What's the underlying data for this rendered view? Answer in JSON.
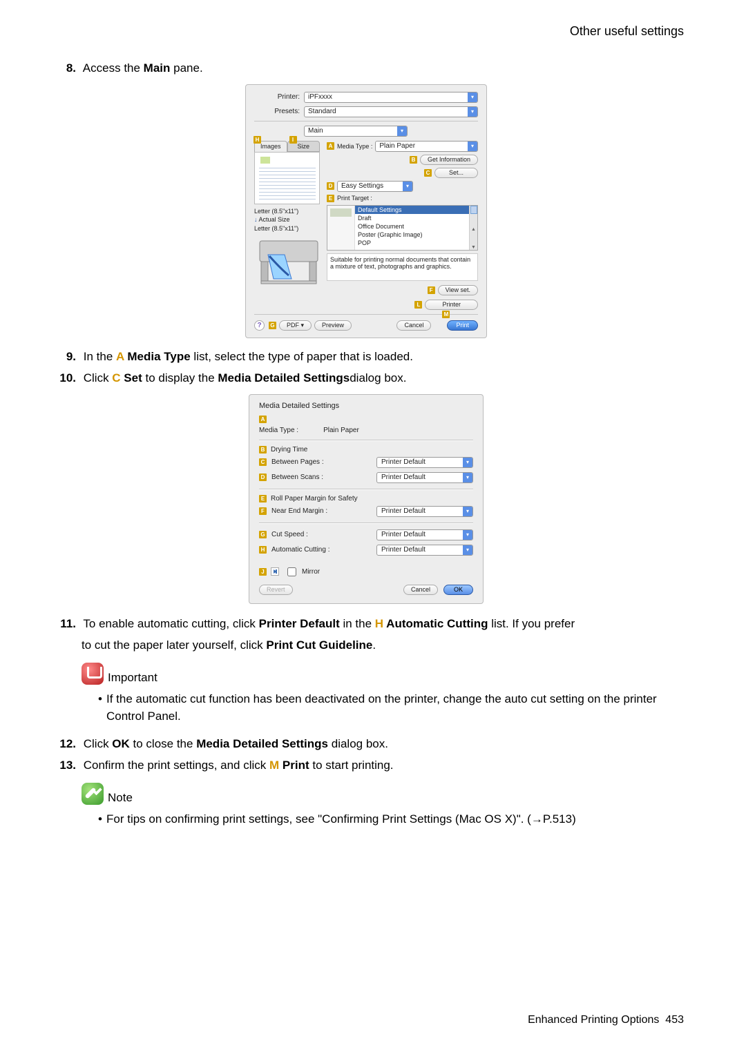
{
  "header": {
    "section_title": "Other useful settings"
  },
  "steps": {
    "s8": {
      "num": "8.",
      "text_pre": "Access the ",
      "bold": "Main",
      "text_post": " pane."
    },
    "s9": {
      "num": "9.",
      "text_pre": "In the ",
      "letter": "A",
      "bold": " Media Type",
      "text_post": " list, select the type of paper that is loaded."
    },
    "s10": {
      "num": "10.",
      "text_pre": "Click ",
      "letter": "C",
      "bold": " Set",
      "text_mid": " to display the ",
      "bold2": "Media Detailed Settings",
      "text_post": "dialog box."
    },
    "s11": {
      "num": "11.",
      "text1": "To enable automatic cutting, click ",
      "b1": "Printer Default",
      "text2": " in the ",
      "letter": "H",
      "b2": " Automatic Cutting",
      "text3": " list. If you prefer",
      "line2a": "to cut the paper later yourself, click ",
      "line2b": "Print Cut Guideline",
      "line2c": "."
    },
    "s12": {
      "num": "12.",
      "t1": "Click ",
      "b1": "OK",
      "t2": " to close the ",
      "b2": "Media Detailed Settings",
      "t3": " dialog box."
    },
    "s13": {
      "num": "13.",
      "t1": "Confirm the print settings, and click ",
      "letter": "M",
      "b1": " Print",
      "t2": " to start printing."
    }
  },
  "dialog1": {
    "printer_lbl": "Printer:",
    "printer_val": "iPFxxxx",
    "presets_lbl": "Presets:",
    "presets_val": "Standard",
    "pane_val": "Main",
    "tab_images": "Images",
    "tab_size": "Size",
    "media_type_lbl": "Media Type :",
    "media_type_val": "Plain Paper",
    "get_info": "Get Information",
    "set_btn": "Set...",
    "easy_lbl": "Easy Settings",
    "target_lbl": "Print Target :",
    "items": {
      "i0": "Default Settings",
      "i1": "Draft",
      "i2": "Office Document",
      "i3": "Poster (Graphic Image)",
      "i4": "POP"
    },
    "desc": "Suitable for printing normal documents that contain a mixture of text, photographs and graphics.",
    "viewset": "View set.",
    "printerbtn": "Printer",
    "size1": "Letter (8.5\"x11\")",
    "size_actual": "Actual Size",
    "size2": "Letter (8.5\"x11\")",
    "pdf": "PDF ▾",
    "preview": "Preview",
    "cancel": "Cancel",
    "print": "Print",
    "tag_H": "H",
    "tag_I": "I",
    "tag_A": "A",
    "tag_B": "B",
    "tag_C": "C",
    "tag_D": "D",
    "tag_E": "E",
    "tag_F": "F",
    "tag_L": "L",
    "tag_G": "G",
    "tag_M": "M"
  },
  "dialog2": {
    "title": "Media Detailed Settings",
    "media_type_lbl": "Media Type :",
    "media_type_val": "Plain Paper",
    "drying_lbl": "Drying Time",
    "pages_lbl": "Between Pages :",
    "scans_lbl": "Between Scans :",
    "roll_lbl": "Roll Paper Margin for Safety",
    "near_lbl": "Near End Margin :",
    "cut_lbl": "Cut Speed :",
    "auto_lbl": "Automatic Cutting :",
    "sel": "Printer Default",
    "mirror": "Mirror",
    "revert": "Revert",
    "cancel": "Cancel",
    "ok": "OK",
    "A": "A",
    "B": "B",
    "C": "C",
    "D": "D",
    "E": "E",
    "F": "F",
    "G": "G",
    "H": "H",
    "J": "J"
  },
  "callouts": {
    "important_title": "Important",
    "important_bullet": "If the automatic cut function has been deactivated on the printer, change the auto cut setting on the printer Control Panel.",
    "note_title": "Note",
    "note_bullet": "For tips on confirming print settings, see \"Confirming Print Settings (Mac OS X)\". (→P.513)"
  },
  "footer": {
    "text": "Enhanced Printing Options",
    "page": "453"
  }
}
